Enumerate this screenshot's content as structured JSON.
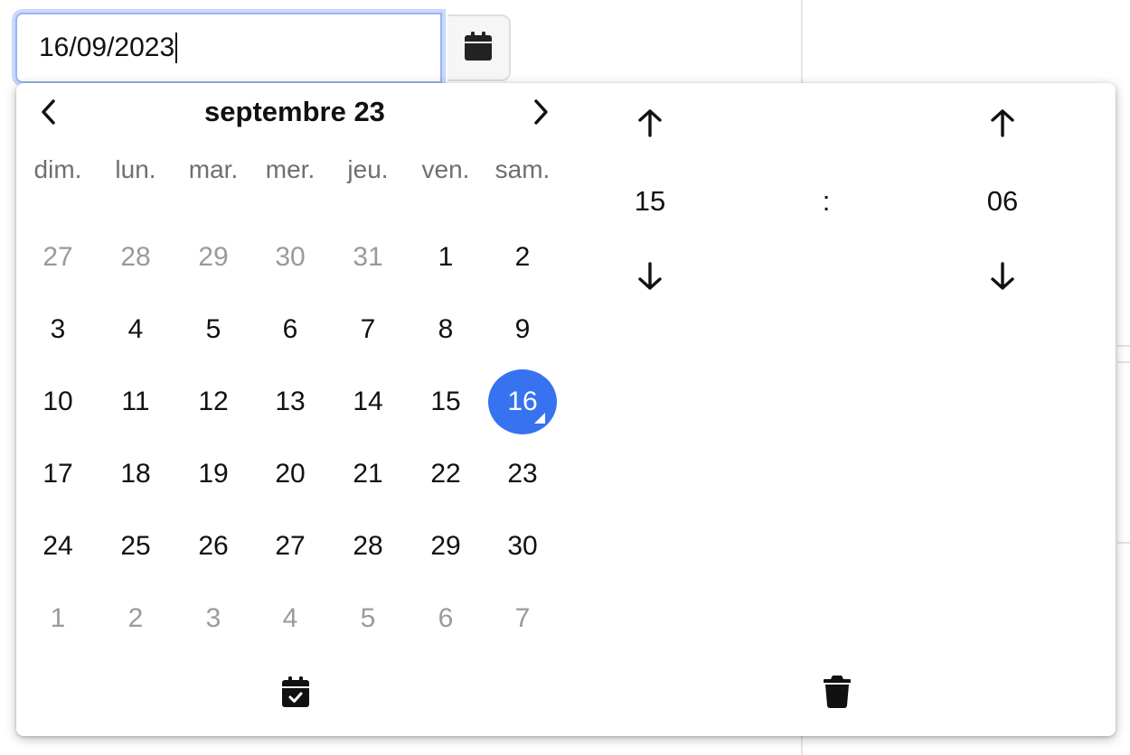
{
  "date_input": {
    "value": "16/09/2023"
  },
  "calendar": {
    "title": "septembre 23",
    "weekdays": [
      "dim.",
      "lun.",
      "mar.",
      "mer.",
      "jeu.",
      "ven.",
      "sam."
    ],
    "weeks": [
      [
        {
          "d": "27",
          "muted": true
        },
        {
          "d": "28",
          "muted": true
        },
        {
          "d": "29",
          "muted": true
        },
        {
          "d": "30",
          "muted": true
        },
        {
          "d": "31",
          "muted": true
        },
        {
          "d": "1"
        },
        {
          "d": "2"
        }
      ],
      [
        {
          "d": "3"
        },
        {
          "d": "4"
        },
        {
          "d": "5"
        },
        {
          "d": "6"
        },
        {
          "d": "7"
        },
        {
          "d": "8"
        },
        {
          "d": "9"
        }
      ],
      [
        {
          "d": "10"
        },
        {
          "d": "11"
        },
        {
          "d": "12"
        },
        {
          "d": "13"
        },
        {
          "d": "14"
        },
        {
          "d": "15"
        },
        {
          "d": "16",
          "selected": true
        }
      ],
      [
        {
          "d": "17"
        },
        {
          "d": "18"
        },
        {
          "d": "19"
        },
        {
          "d": "20"
        },
        {
          "d": "21"
        },
        {
          "d": "22"
        },
        {
          "d": "23"
        }
      ],
      [
        {
          "d": "24"
        },
        {
          "d": "25"
        },
        {
          "d": "26"
        },
        {
          "d": "27"
        },
        {
          "d": "28"
        },
        {
          "d": "29"
        },
        {
          "d": "30"
        }
      ],
      [
        {
          "d": "1",
          "muted": true
        },
        {
          "d": "2",
          "muted": true
        },
        {
          "d": "3",
          "muted": true
        },
        {
          "d": "4",
          "muted": true
        },
        {
          "d": "5",
          "muted": true
        },
        {
          "d": "6",
          "muted": true
        },
        {
          "d": "7",
          "muted": true
        }
      ]
    ]
  },
  "time": {
    "hours": "15",
    "separator": ":",
    "minutes": "06"
  },
  "icons": {
    "toggle": "calendar-icon",
    "prev": "chevron-left-icon",
    "next": "chevron-right-icon",
    "up": "arrow-up-icon",
    "down": "arrow-down-icon",
    "today": "calendar-check-icon",
    "clear": "trash-icon"
  },
  "colors": {
    "accent": "#3772f0",
    "muted_text": "#9a9a9a",
    "weekday_text": "#6f6f6f"
  }
}
